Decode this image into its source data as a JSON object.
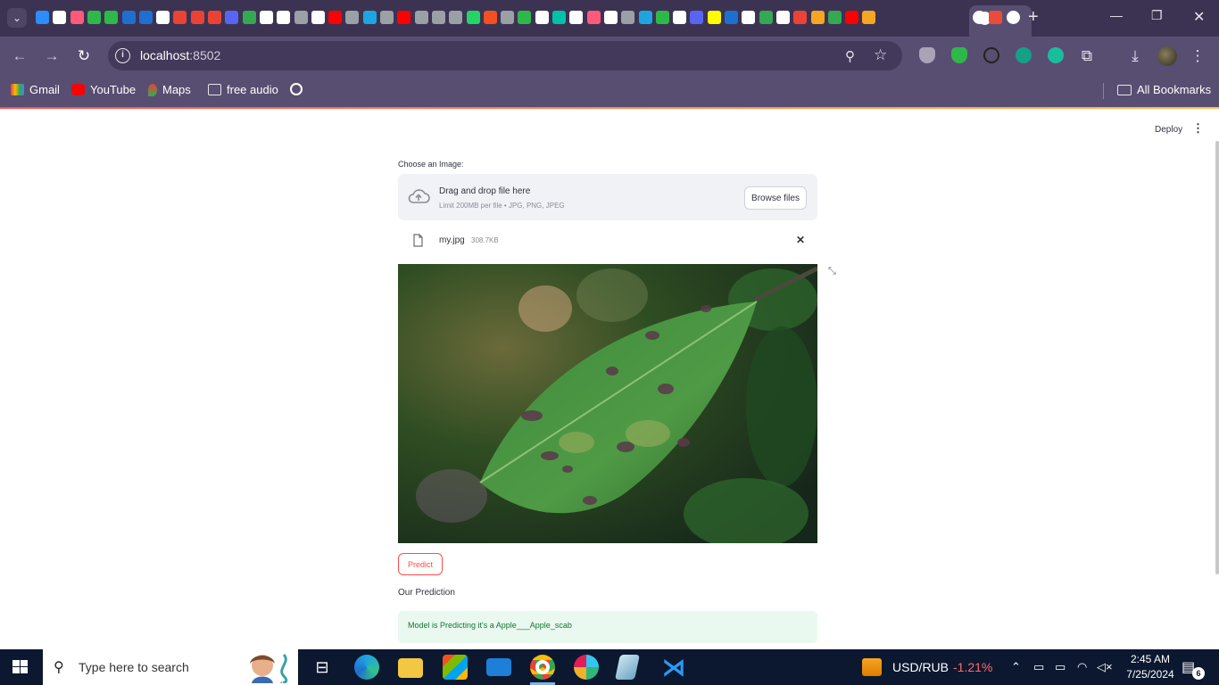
{
  "browser": {
    "url_host": "localhost",
    "url_port": ":8502",
    "active_tab_close": "✕",
    "new_tab": "+"
  },
  "bookmarks": {
    "gmail": "Gmail",
    "youtube": "YouTube",
    "maps": "Maps",
    "free_audio": "free audio",
    "all_bookmarks": "All Bookmarks"
  },
  "app": {
    "deploy_label": "Deploy",
    "uploader_label": "Choose an Image:",
    "drop_title": "Drag and drop file here",
    "drop_limit": "Limit 200MB per file • JPG, PNG, JPEG",
    "browse_label": "Browse files",
    "file_name": "my.jpg",
    "file_size": "308.7KB",
    "predict_label": "Predict",
    "prediction_heading": "Our Prediction",
    "prediction_text": "Model is Predicting it's a Apple___Apple_scab"
  },
  "taskbar": {
    "search_placeholder": "Type here to search",
    "ticker": "USD/RUB",
    "ticker_change": "-1.21%",
    "time": "2:45 AM",
    "date": "7/25/2024",
    "notification_count": "6"
  },
  "colors": {
    "accent": "#ff4b4b",
    "success_bg": "#e9f9ef",
    "success_text": "#177233",
    "browser_frame": "#584e71"
  }
}
